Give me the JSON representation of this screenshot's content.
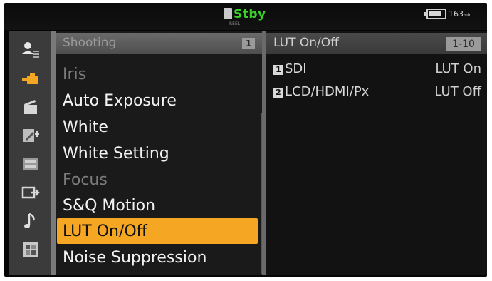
{
  "status": {
    "mode": "Stby",
    "sub": "REEL"
  },
  "battery": {
    "level": 0.85,
    "text": "163",
    "unit": "min"
  },
  "menu": {
    "title": "Shooting",
    "page": "1",
    "items": [
      {
        "label": "Iris",
        "state": "dim"
      },
      {
        "label": "Auto Exposure",
        "state": "normal"
      },
      {
        "label": "White",
        "state": "normal"
      },
      {
        "label": "White Setting",
        "state": "normal"
      },
      {
        "label": "Focus",
        "state": "dim"
      },
      {
        "label": "S&Q Motion",
        "state": "normal"
      },
      {
        "label": "LUT On/Off",
        "state": "selected"
      },
      {
        "label": "Noise Suppression",
        "state": "normal"
      }
    ]
  },
  "detail": {
    "title": "LUT On/Off",
    "page": "1-10",
    "rows": [
      {
        "num": "1",
        "label": "SDI",
        "value": "LUT On"
      },
      {
        "num": "2",
        "label": "LCD/HDMI/Px",
        "value": "LUT Off"
      }
    ]
  },
  "colors": {
    "selection": "#f5a623",
    "status_green": "#3ad12a"
  },
  "icons": [
    "user-menu-icon",
    "camera-shooting-icon",
    "clapper-icon",
    "edit-icon",
    "media-icon",
    "output-icon",
    "audio-note-icon",
    "system-grid-icon"
  ]
}
